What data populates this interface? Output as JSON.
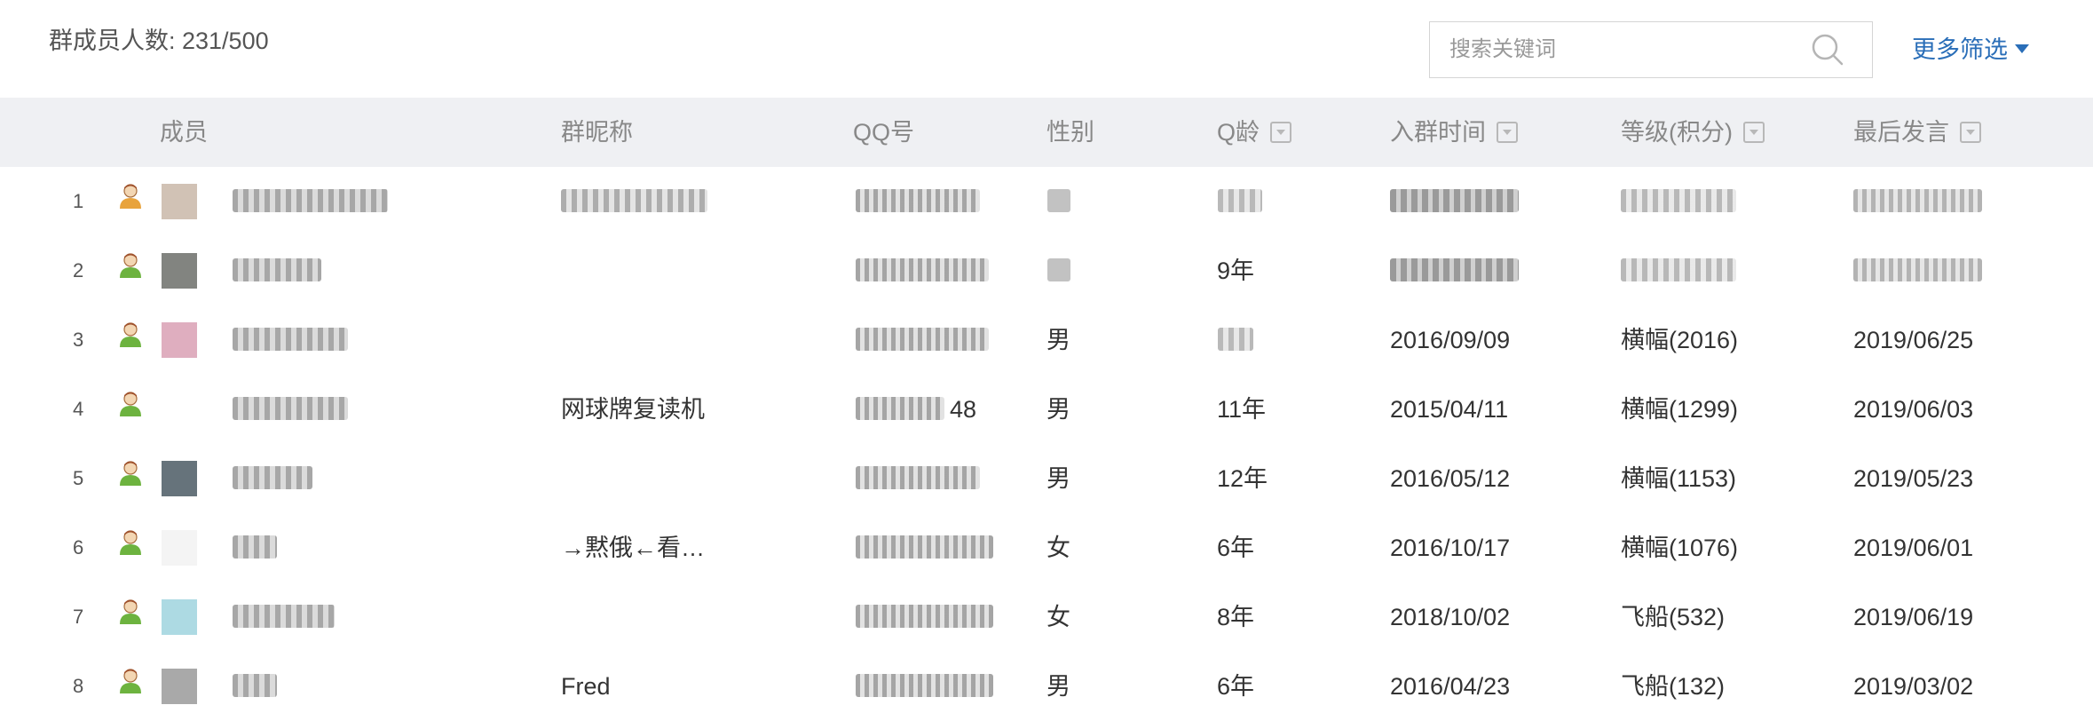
{
  "top": {
    "member_count": "群成员人数: 231/500",
    "search_placeholder": "搜索关键词",
    "more_filter": "更多筛选"
  },
  "columns": {
    "member": "成员",
    "group_nick": "群昵称",
    "qq": "QQ号",
    "gender": "性别",
    "qq_age": "Q龄",
    "join_time": "入群时间",
    "level": "等级(积分)",
    "last_speak": "最后发言"
  },
  "colors": {
    "header_bg": "#eff0f3",
    "link": "#2a6eb8",
    "owner_icon": "#e8a33c",
    "member_icon": "#6db33f"
  },
  "rows": [
    {
      "index": "1",
      "role": "owner",
      "group_nick": "",
      "qq_suffix": "",
      "gender": "",
      "qq_age": "",
      "join_time": "",
      "level": "",
      "last_speak": ""
    },
    {
      "index": "2",
      "role": "member",
      "group_nick": "",
      "qq_suffix": "",
      "gender": "",
      "qq_age": "9年",
      "join_time": "",
      "level": "",
      "last_speak": ""
    },
    {
      "index": "3",
      "role": "member",
      "group_nick": "",
      "qq_suffix": "",
      "gender": "男",
      "qq_age": "",
      "join_time": "2016/09/09",
      "level": "横幅(2016)",
      "last_speak": "2019/06/25"
    },
    {
      "index": "4",
      "role": "member",
      "group_nick": "网球牌复读机",
      "qq_suffix": "48",
      "gender": "男",
      "qq_age": "11年",
      "join_time": "2015/04/11",
      "level": "横幅(1299)",
      "last_speak": "2019/06/03"
    },
    {
      "index": "5",
      "role": "member",
      "group_nick": "",
      "qq_suffix": "",
      "gender": "男",
      "qq_age": "12年",
      "join_time": "2016/05/12",
      "level": "横幅(1153)",
      "last_speak": "2019/05/23"
    },
    {
      "index": "6",
      "role": "member",
      "group_nick": "→黙俄←看…",
      "qq_suffix": "",
      "gender": "女",
      "qq_age": "6年",
      "join_time": "2016/10/17",
      "level": "横幅(1076)",
      "last_speak": "2019/06/01"
    },
    {
      "index": "7",
      "role": "member",
      "group_nick": "",
      "qq_suffix": "",
      "gender": "女",
      "qq_age": "8年",
      "join_time": "2018/10/02",
      "level": "飞船(532)",
      "last_speak": "2019/06/19"
    },
    {
      "index": "8",
      "role": "member",
      "group_nick": "Fred",
      "qq_suffix": "",
      "gender": "男",
      "qq_age": "6年",
      "join_time": "2016/04/23",
      "level": "飞船(132)",
      "last_speak": "2019/03/02"
    }
  ]
}
